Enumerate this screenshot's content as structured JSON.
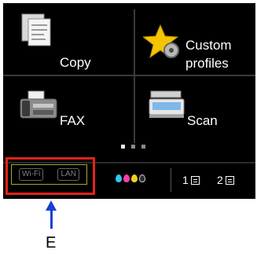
{
  "tiles": {
    "copy": {
      "label": "Copy"
    },
    "custom_profiles": {
      "label_line1": "Custom",
      "label_line2": "profiles"
    },
    "fax": {
      "label": "FAX"
    },
    "scan": {
      "label": "Scan"
    }
  },
  "pager": {
    "count": 3,
    "active_index": 0
  },
  "status": {
    "wifi_label": "Wi-Fi",
    "lan_label": "LAN",
    "ink_colors": [
      "#35c4f0",
      "#ff3fa8",
      "#f0d21a",
      "#2a2a2a"
    ],
    "tray1_label": "1",
    "tray2_label": "2"
  },
  "callout": {
    "letter": "E"
  },
  "colors": {
    "highlight": "#e0231b",
    "arrow": "#1a3fd6",
    "net_frame": "#a6a633"
  },
  "icons": [
    "document-copy-icon",
    "star-gear-icon",
    "fax-machine-icon",
    "scanner-icon",
    "ink-drops-icon",
    "paper-tray-icon"
  ]
}
